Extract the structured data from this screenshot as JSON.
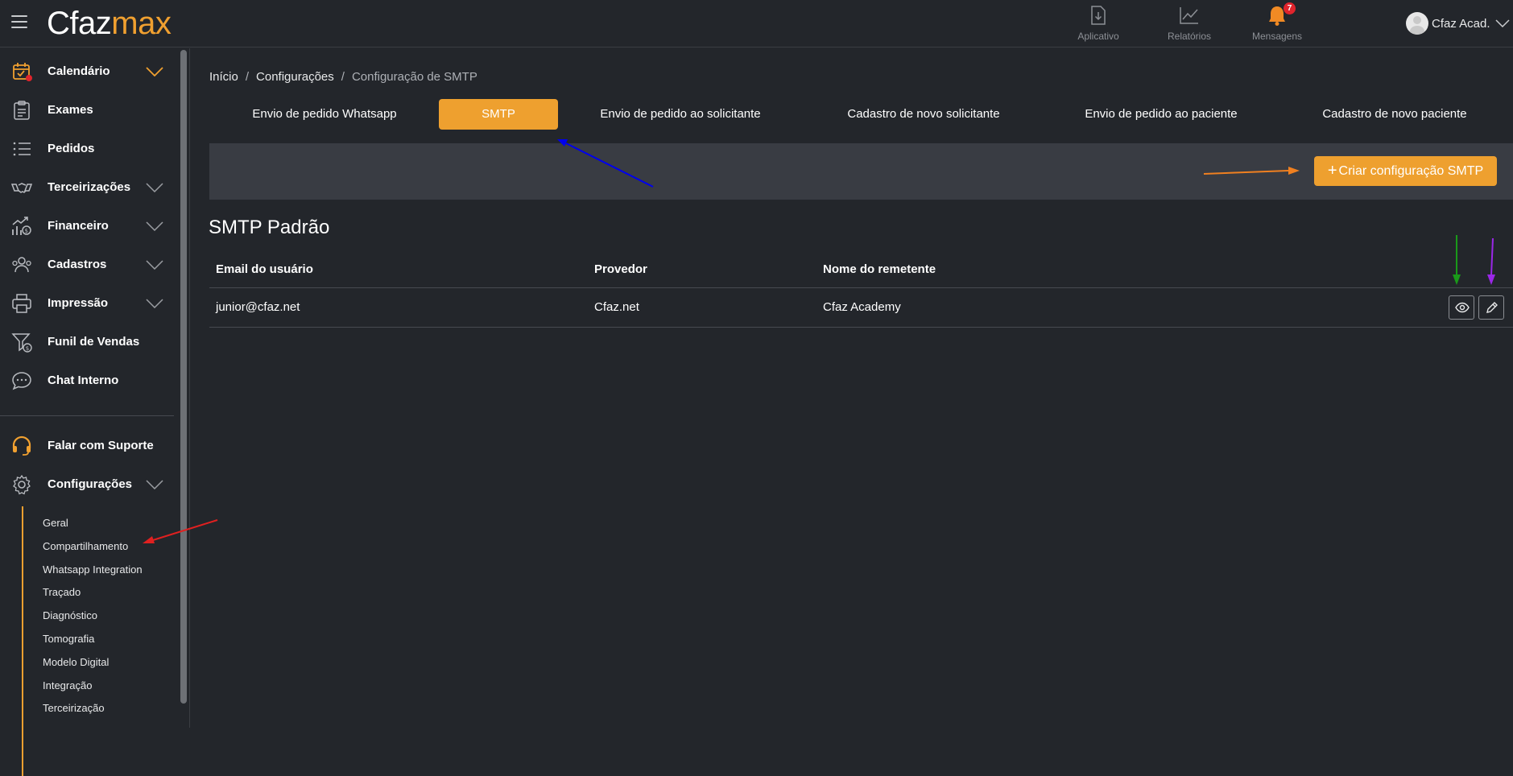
{
  "app": {
    "logo_part1": "Cfaz",
    "logo_part2": "max"
  },
  "topnav": [
    {
      "label": "Aplicativo",
      "icon": "download-app-icon"
    },
    {
      "label": "Relatórios",
      "icon": "chart-icon"
    },
    {
      "label": "Mensagens",
      "icon": "bell-icon",
      "badge": "7"
    }
  ],
  "user": {
    "name": "Cfaz Acad."
  },
  "sidebar": {
    "items": [
      {
        "label": "Calendário",
        "icon": "calendar-icon"
      },
      {
        "label": "Exames",
        "icon": "clipboard-icon"
      },
      {
        "label": "Pedidos",
        "icon": "list-icon"
      },
      {
        "label": "Terceirizações",
        "icon": "handshake-icon"
      },
      {
        "label": "Financeiro",
        "icon": "finance-icon"
      },
      {
        "label": "Cadastros",
        "icon": "users-icon"
      },
      {
        "label": "Impressão",
        "icon": "printer-icon"
      },
      {
        "label": "Funil de Vendas",
        "icon": "funnel-icon"
      },
      {
        "label": "Chat Interno",
        "icon": "chat-icon"
      },
      {
        "label": "Falar com Suporte",
        "icon": "headset-icon"
      },
      {
        "label": "Configurações",
        "icon": "gear-icon"
      }
    ],
    "sub_items": [
      "Geral",
      "Compartilhamento",
      "Whatsapp Integration",
      "Traçado",
      "Diagnóstico",
      "Tomografia",
      "Modelo Digital",
      "Integração",
      "Terceirização"
    ]
  },
  "breadcrumb": [
    "Início",
    "Configurações",
    "Configuração de SMTP"
  ],
  "tabs": [
    "Envio de pedido Whatsapp",
    "SMTP",
    "Envio de pedido ao solicitante",
    "Cadastro de novo solicitante",
    "Envio de pedido ao paciente",
    "Cadastro de novo paciente"
  ],
  "active_tab": "SMTP",
  "create_button": "Criar configuração SMTP",
  "section_title": "SMTP Padrão",
  "table": {
    "headers": [
      "Email do usuário",
      "Provedor",
      "Nome do remetente"
    ],
    "rows": [
      [
        "junior@cfaz.net",
        "Cfaz.net",
        "Cfaz Academy"
      ]
    ]
  },
  "colors": {
    "accent": "#eea02f",
    "background": "#23262b",
    "panel": "#393c43"
  },
  "annotation_arrows": [
    {
      "color": "#0000ee",
      "points_to": "tab SMTP"
    },
    {
      "color": "#f08020",
      "points_to": "create button"
    },
    {
      "color": "#1a9a1a",
      "points_to": "view button"
    },
    {
      "color": "#9b27e8",
      "points_to": "edit button"
    },
    {
      "color": "#e02020",
      "points_to": "Compartilhamento"
    }
  ]
}
